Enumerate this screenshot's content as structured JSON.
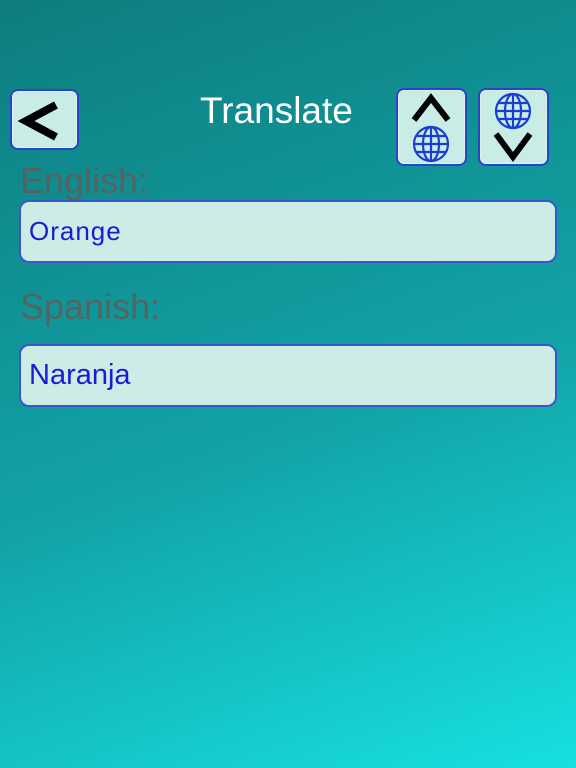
{
  "header": {
    "title": "Translate",
    "back_icon": "back-chevron-icon",
    "swap_up_icon": "chevron-up-globe-icon",
    "swap_down_icon": "globe-chevron-down-icon"
  },
  "source": {
    "label": "English:",
    "value": "Orange"
  },
  "target": {
    "label": "Spanish:",
    "value": "Naranja"
  },
  "colors": {
    "background_top": "#0e7d7f",
    "background_bottom": "#17e0e0",
    "field_text": "#1a1ad8",
    "field_bg": "#cdece5",
    "border": "#2a44c8",
    "label_text": "#5e5e5e"
  }
}
